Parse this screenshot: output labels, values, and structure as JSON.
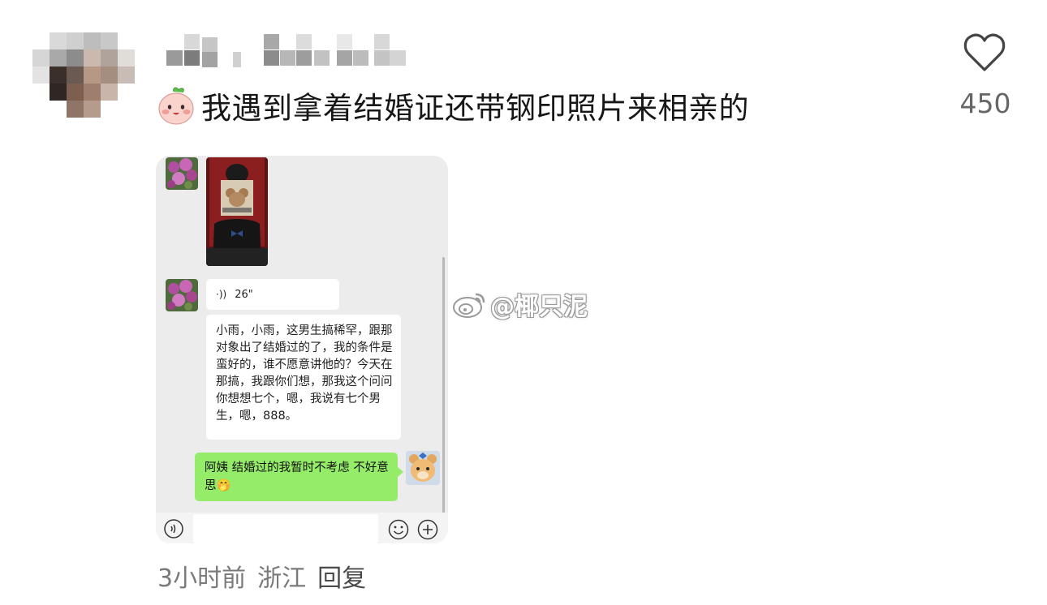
{
  "comment": {
    "text": "我遇到拿着结婚证还带钢印照片来相亲的",
    "likes": "450",
    "time": "3小时前",
    "location": "浙江",
    "reply_label": "回复"
  },
  "chat_screenshot": {
    "voice_duration": "26\"",
    "incoming_text": "小雨，小雨，这男生搞稀罕，跟那对象出了结婚过的了，我的条件是蛮好的，谁不愿意讲他的？今天在那搞，我跟你们想，那我这个问问你想想七个，嗯，我说有七个男生，嗯，888。",
    "outgoing_text": "阿姨 结婚过的我暂时不考虑 不好意思",
    "outgoing_emoji": "🤭"
  },
  "watermark": {
    "text": "@椰只泥"
  },
  "icons": {
    "like": "heart-outline-icon",
    "voice": "voice-wave-icon",
    "emoji": "smiley-icon",
    "plus": "plus-circle-icon",
    "weibo": "weibo-logo-icon"
  },
  "colors": {
    "like_count": "#666666",
    "meta_text": "#7a7a7a",
    "outgoing_bubble": "#95ec69",
    "chat_background": "#ececec"
  }
}
